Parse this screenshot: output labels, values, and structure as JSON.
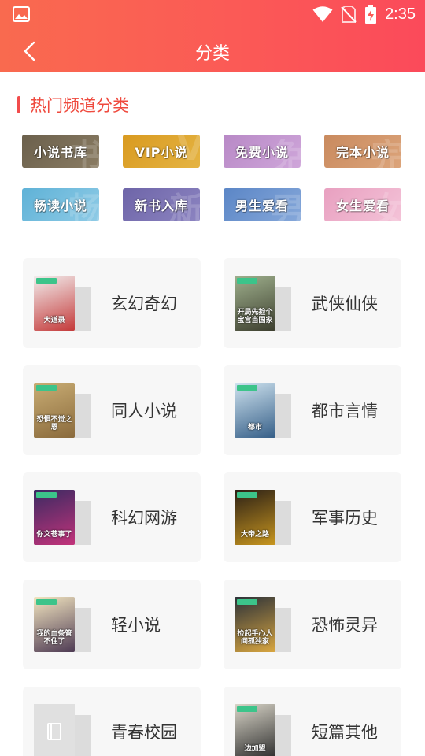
{
  "status": {
    "time": "2:35"
  },
  "nav": {
    "title": "分类"
  },
  "section": {
    "title": "热门频道分类"
  },
  "tags": [
    {
      "label": "小说书库",
      "glyph": "书",
      "colors": [
        "#6b604c",
        "#8a7c63"
      ]
    },
    {
      "label": "VIP小说",
      "glyph": "V",
      "colors": [
        "#d99a20",
        "#e5b443"
      ]
    },
    {
      "label": "免费小说",
      "glyph": "免",
      "colors": [
        "#b889c6",
        "#cfa6da"
      ]
    },
    {
      "label": "完本小说",
      "glyph": "完",
      "colors": [
        "#c98a5e",
        "#dca47a"
      ]
    },
    {
      "label": "畅读小说",
      "glyph": "畅",
      "colors": [
        "#5fb2d7",
        "#8fcbe6"
      ]
    },
    {
      "label": "新书入库",
      "glyph": "新",
      "colors": [
        "#6e65a8",
        "#8c84c1"
      ]
    },
    {
      "label": "男生爱看",
      "glyph": "男",
      "colors": [
        "#5b86c6",
        "#86a8da"
      ]
    },
    {
      "label": "女生爱看",
      "glyph": "女",
      "colors": [
        "#e8a0c0",
        "#f4c3d8"
      ]
    }
  ],
  "categories": [
    {
      "label": "玄幻奇幻",
      "cover_text": "大道录",
      "colors": [
        "#f2eeee",
        "#c43a3a"
      ]
    },
    {
      "label": "武侠仙侠",
      "cover_text": "开局先捡个宝宫当国家",
      "colors": [
        "#9fb08d",
        "#3d3f2f"
      ]
    },
    {
      "label": "同人小说",
      "cover_text": "恐惧不觉之恩",
      "colors": [
        "#c9ad74",
        "#8a6a3c"
      ]
    },
    {
      "label": "都市言情",
      "cover_text": "都市",
      "colors": [
        "#cfe3ef",
        "#365f88"
      ]
    },
    {
      "label": "科幻网游",
      "cover_text": "你文苍事了",
      "colors": [
        "#3a2a62",
        "#c2337a"
      ]
    },
    {
      "label": "军事历史",
      "cover_text": "大帝之路",
      "colors": [
        "#2a1f16",
        "#c8961f"
      ]
    },
    {
      "label": "轻小说",
      "cover_text": "我的血条管不住了",
      "colors": [
        "#f3e6c0",
        "#4e3b54"
      ]
    },
    {
      "label": "恐怖灵异",
      "cover_text": "捡起手心人间孤独家",
      "colors": [
        "#2b3139",
        "#d9a640"
      ]
    },
    {
      "label": "青春校园",
      "cover_text": "",
      "colors": [
        "#e0e0e0",
        "#cccccc"
      ]
    },
    {
      "label": "短篇其他",
      "cover_text": "边加盟",
      "colors": [
        "#d9d5c8",
        "#2b2b2b"
      ]
    }
  ]
}
